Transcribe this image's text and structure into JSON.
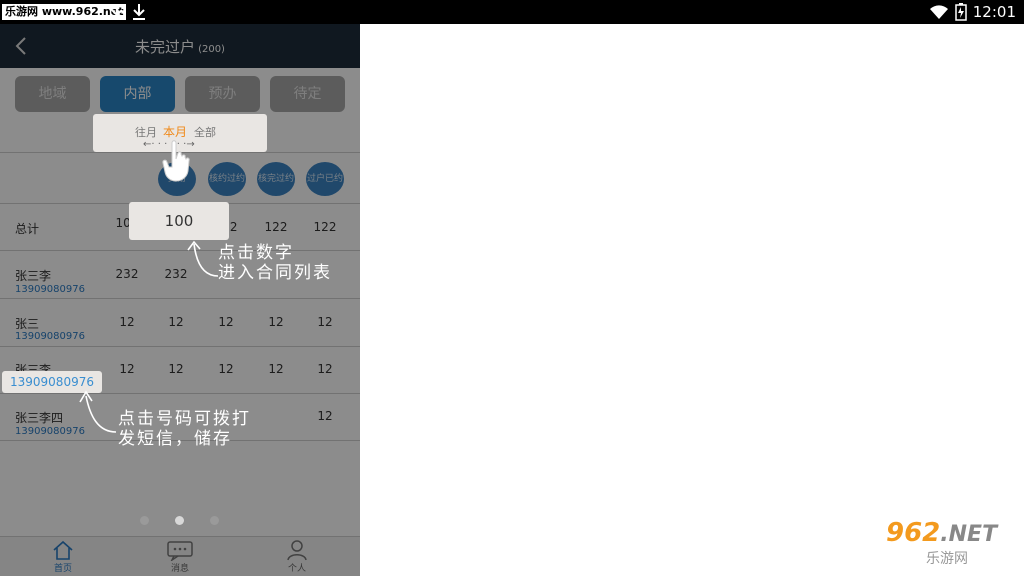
{
  "statusbar": {
    "brand": "乐游网 www.962.net",
    "time": "12:01"
  },
  "header": {
    "title": "未完过户",
    "count": "(200)"
  },
  "tabs": [
    "地域",
    "内部",
    "预办",
    "待定"
  ],
  "active_tab": "内部",
  "filter": {
    "options": [
      "往月",
      "本月",
      "全部"
    ],
    "active": "本月",
    "arrows": "←· · ·    · · ·→"
  },
  "columns": [
    "交易",
    "核约过约",
    "核完过约",
    "过户已约"
  ],
  "rows": [
    {
      "name": "总计",
      "phone": "",
      "values": [
        "100",
        "100",
        "122",
        "122",
        "122"
      ]
    },
    {
      "name": "张三李",
      "phone": "13909080976",
      "values": [
        "232",
        "232",
        "",
        "",
        ""
      ]
    },
    {
      "name": "张三",
      "phone": "13909080976",
      "values": [
        "12",
        "12",
        "12",
        "12",
        "12"
      ]
    },
    {
      "name": "张三李",
      "phone": "13909080976",
      "values": [
        "12",
        "12",
        "12",
        "12",
        "12"
      ]
    },
    {
      "name": "张三李四",
      "phone": "13909080976",
      "values": [
        "",
        "",
        "",
        "",
        "12"
      ]
    }
  ],
  "popup_number": "100",
  "popup_phone": "13909080976",
  "notes": {
    "number": [
      "点击数字",
      "进入合同列表"
    ],
    "phone": [
      "点击号码可拨打",
      "发短信，储存"
    ]
  },
  "nav": [
    "首页",
    "消息",
    "个人"
  ],
  "watermark": {
    "top": "962",
    "net": ".NET",
    "bottom": "乐游网"
  },
  "colors": {
    "accent": "#2a85c6",
    "highlight": "#f08a1a",
    "titlebar": "#1e2d3b"
  }
}
